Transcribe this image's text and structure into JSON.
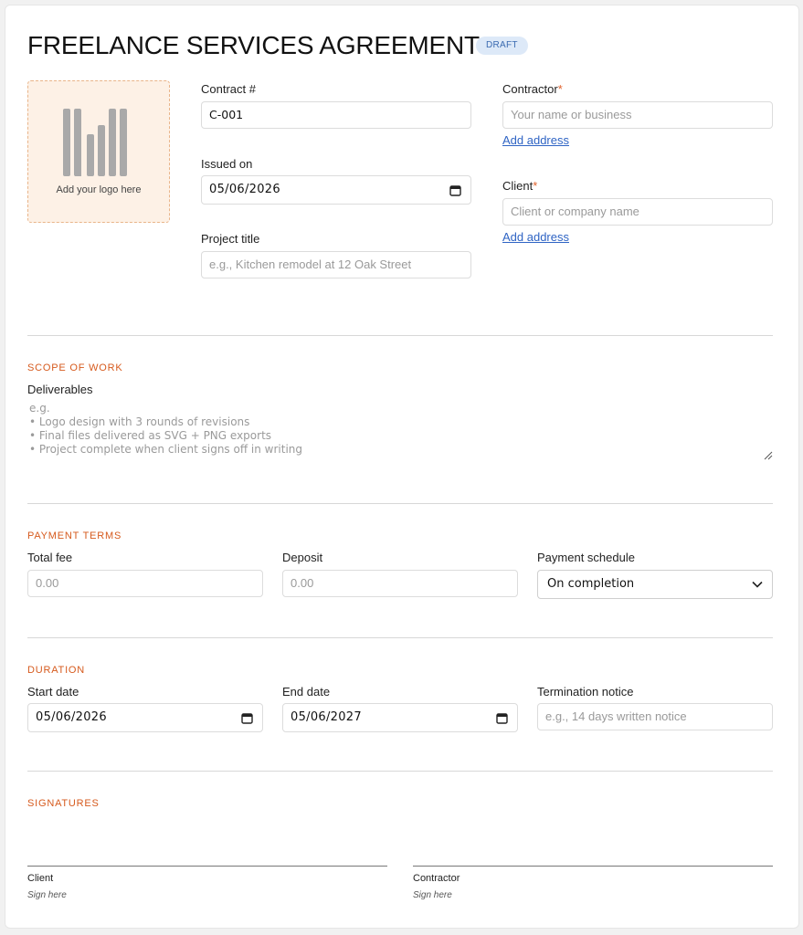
{
  "header": {
    "title": "FREELANCE SERVICES AGREEMENT",
    "badge": "DRAFT"
  },
  "logo": {
    "label": "Add your logo here",
    "icon": "logo-placeholder-icon"
  },
  "contract": {
    "number_label": "Contract #",
    "number_value": "C-001",
    "issued_label": "Issued on",
    "issued_value": "05/06/2026",
    "project_label": "Project title",
    "project_placeholder": "e.g., Kitchen remodel at 12 Oak Street"
  },
  "contractor": {
    "label": "Contractor",
    "required_mark": "*",
    "placeholder": "Your name or business",
    "add_address": "Add address"
  },
  "client": {
    "label": "Client",
    "required_mark": "*",
    "placeholder": "Client or company name",
    "add_address": "Add address"
  },
  "scope": {
    "section_title": "SCOPE OF WORK",
    "deliverables_label": "Deliverables",
    "placeholder_lines": [
      "e.g.",
      "• Logo design with 3 rounds of revisions",
      "• Final files delivered as SVG + PNG exports",
      "• Project complete when client signs off in writing"
    ]
  },
  "payment": {
    "section_title": "PAYMENT TERMS",
    "total_fee_label": "Total fee",
    "total_fee_placeholder": "0.00",
    "deposit_label": "Deposit",
    "deposit_placeholder": "0.00",
    "schedule_label": "Payment schedule",
    "schedule_value": "On completion"
  },
  "duration": {
    "section_title": "DURATION",
    "start_label": "Start date",
    "start_value": "05/06/2026",
    "end_label": "End date",
    "end_value": "05/06/2027",
    "termination_label": "Termination notice",
    "termination_placeholder": "e.g., 14 days written notice"
  },
  "signatures": {
    "section_title": "SIGNATURES",
    "client_label": "Client",
    "client_hint": "Sign here",
    "contractor_label": "Contractor",
    "contractor_hint": "Sign here"
  },
  "colors": {
    "accent": "#d65a1d",
    "link": "#2f64c4",
    "badge_bg": "#dde9f8",
    "logo_bg": "#fdf1e6"
  }
}
